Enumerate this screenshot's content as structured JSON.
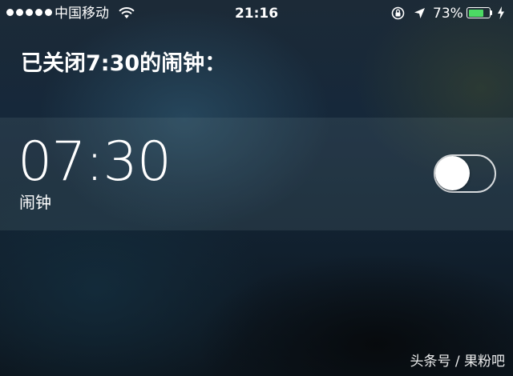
{
  "status_bar": {
    "carrier": "中国移动",
    "time": "21:16",
    "battery_percent": "73%",
    "battery_level": 0.73,
    "signal_strength_dots": 5,
    "icons": [
      "signal-dots",
      "wifi-icon",
      "orientation-lock-icon",
      "location-arrow-icon",
      "battery-icon",
      "charging-bolt-icon"
    ],
    "battery_color": "#4cd964"
  },
  "siri": {
    "response": "已关闭7:30的闹钟："
  },
  "alarm": {
    "time": "07:30",
    "label": "闹钟",
    "enabled": false
  },
  "watermark": "头条号 / 果粉吧"
}
